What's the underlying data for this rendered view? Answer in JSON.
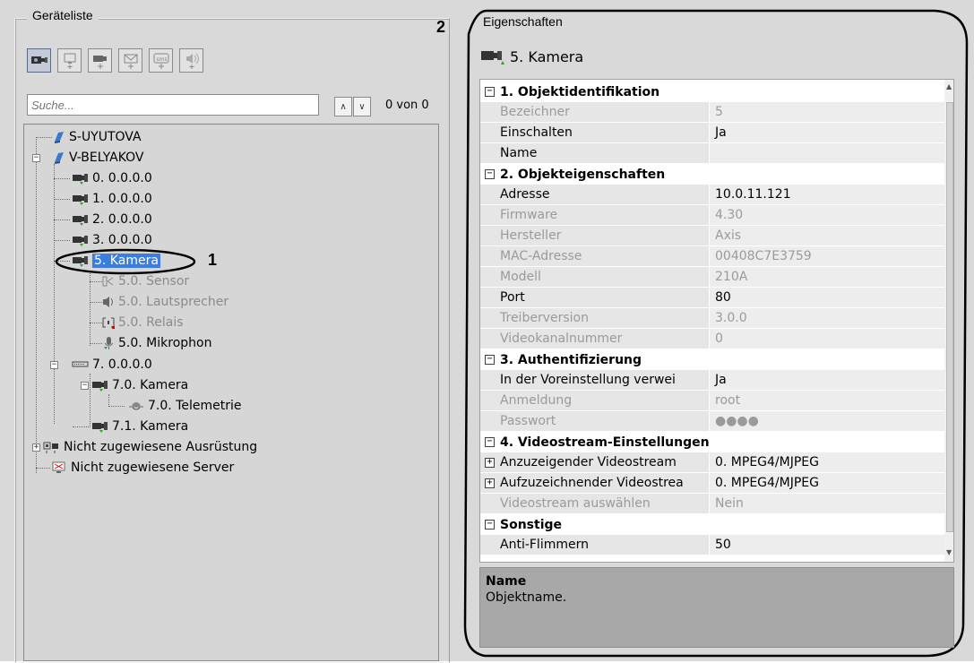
{
  "device_list": {
    "title": "Geräteliste",
    "toolbar": [
      {
        "icon": "camera-search-icon",
        "active": true
      },
      {
        "icon": "add-monitor-icon",
        "active": false
      },
      {
        "icon": "add-camera-icon",
        "active": false
      },
      {
        "icon": "add-email-icon",
        "active": false
      },
      {
        "icon": "add-sms-icon",
        "active": false
      },
      {
        "icon": "add-speaker-icon",
        "active": false
      }
    ],
    "search": {
      "placeholder": "Suche...",
      "value": "",
      "count": "0 von 0"
    },
    "tree": [
      {
        "label": "S-UYUTOVA"
      },
      {
        "label": "V-BELYAKOV"
      },
      {
        "label": "0. 0.0.0.0"
      },
      {
        "label": "1. 0.0.0.0"
      },
      {
        "label": "2. 0.0.0.0"
      },
      {
        "label": "3. 0.0.0.0"
      },
      {
        "label": "5. Kamera"
      },
      {
        "label": "5.0. Sensor"
      },
      {
        "label": "5.0. Lautsprecher"
      },
      {
        "label": "5.0. Relais"
      },
      {
        "label": "5.0. Mikrophon"
      },
      {
        "label": "7. 0.0.0.0"
      },
      {
        "label": "7.0. Kamera"
      },
      {
        "label": "7.0. Telemetrie"
      },
      {
        "label": "7.1. Kamera"
      },
      {
        "label": "Nicht zugewiesene Ausrüstung"
      },
      {
        "label": "Nicht zugewiesene Server"
      }
    ]
  },
  "properties": {
    "title": "Eigenschaften",
    "object_name": "5. Kamera",
    "rows": [
      {
        "kind": "cat",
        "label": "1. Objektidentifikation"
      },
      {
        "kind": "ro",
        "name": "Bezeichner",
        "value": "5"
      },
      {
        "kind": "rw",
        "name": "Einschalten",
        "value": "Ja"
      },
      {
        "kind": "rw",
        "name": "Name",
        "value": ""
      },
      {
        "kind": "cat",
        "label": "2. Objekteigenschaften"
      },
      {
        "kind": "rw",
        "name": "Adresse",
        "value": "10.0.11.121"
      },
      {
        "kind": "ro",
        "name": "Firmware",
        "value": "4.30"
      },
      {
        "kind": "ro",
        "name": "Hersteller",
        "value": "Axis"
      },
      {
        "kind": "ro",
        "name": "MAC-Adresse",
        "value": "00408C7E3759"
      },
      {
        "kind": "ro",
        "name": "Modell",
        "value": "210A"
      },
      {
        "kind": "rw",
        "name": "Port",
        "value": "80"
      },
      {
        "kind": "ro",
        "name": "Treiberversion",
        "value": "3.0.0"
      },
      {
        "kind": "ro",
        "name": "Videokanalnummer",
        "value": "0"
      },
      {
        "kind": "cat",
        "label": "3. Authentifizierung"
      },
      {
        "kind": "rw",
        "name": "In der Voreinstellung verwei",
        "value": "Ja"
      },
      {
        "kind": "ro",
        "name": "Anmeldung",
        "value": "root"
      },
      {
        "kind": "ro",
        "name": "Passwort",
        "value": "●●●●"
      },
      {
        "kind": "cat",
        "label": "4. Videostream-Einstellungen"
      },
      {
        "kind": "exp",
        "name": "Anzuzeigender Videostream",
        "value": "0. MPEG4/MJPEG"
      },
      {
        "kind": "exp",
        "name": "Aufzuzeichnender Videostrea",
        "value": "0. MPEG4/MJPEG"
      },
      {
        "kind": "ro",
        "name": "Videostream auswählen",
        "value": "Nein"
      },
      {
        "kind": "cat",
        "label": "Sonstige"
      },
      {
        "kind": "rw",
        "name": "Anti-Flimmern",
        "value": "50"
      }
    ],
    "description": {
      "title": "Name",
      "text": "Objektname."
    }
  },
  "annotations": {
    "one": "1",
    "two": "2"
  }
}
